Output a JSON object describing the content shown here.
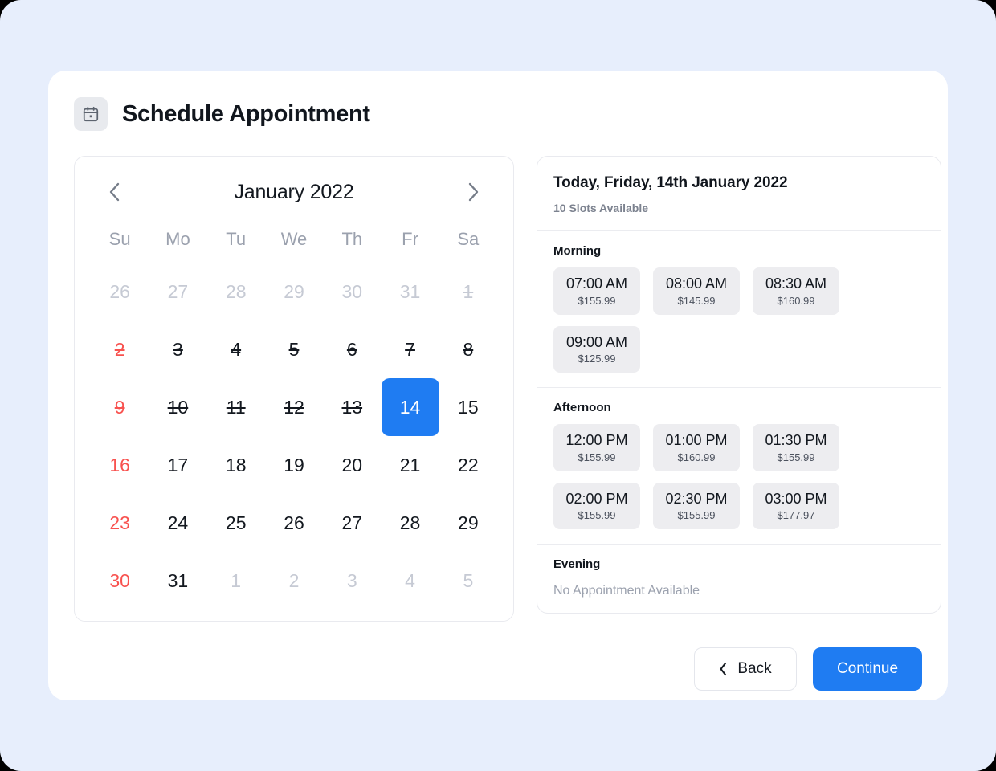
{
  "header": {
    "icon": "calendar-icon",
    "title": "Schedule Appointment"
  },
  "calendar": {
    "prev_icon": "chevron-left-icon",
    "next_icon": "chevron-right-icon",
    "month_label": "January 2022",
    "weekday_labels": [
      "Su",
      "Mo",
      "Tu",
      "We",
      "Th",
      "Fr",
      "Sa"
    ],
    "selected_day": "14",
    "accent_color": "#1f7cf2",
    "weekend_color": "#f8524f",
    "muted_color": "#c6cad4",
    "weeks": [
      [
        {
          "label": "26",
          "state": "outside"
        },
        {
          "label": "27",
          "state": "outside"
        },
        {
          "label": "28",
          "state": "outside"
        },
        {
          "label": "29",
          "state": "outside"
        },
        {
          "label": "30",
          "state": "outside"
        },
        {
          "label": "31",
          "state": "outside"
        },
        {
          "label": "1",
          "state": "outside-past"
        }
      ],
      [
        {
          "label": "2",
          "state": "past-weekend"
        },
        {
          "label": "3",
          "state": "past"
        },
        {
          "label": "4",
          "state": "past"
        },
        {
          "label": "5",
          "state": "past"
        },
        {
          "label": "6",
          "state": "past"
        },
        {
          "label": "7",
          "state": "past"
        },
        {
          "label": "8",
          "state": "past"
        }
      ],
      [
        {
          "label": "9",
          "state": "past-weekend"
        },
        {
          "label": "10",
          "state": "past"
        },
        {
          "label": "11",
          "state": "past"
        },
        {
          "label": "12",
          "state": "past"
        },
        {
          "label": "13",
          "state": "past"
        },
        {
          "label": "14",
          "state": "selected"
        },
        {
          "label": "15",
          "state": "available"
        }
      ],
      [
        {
          "label": "16",
          "state": "weekend"
        },
        {
          "label": "17",
          "state": "available"
        },
        {
          "label": "18",
          "state": "available"
        },
        {
          "label": "19",
          "state": "available"
        },
        {
          "label": "20",
          "state": "available"
        },
        {
          "label": "21",
          "state": "available"
        },
        {
          "label": "22",
          "state": "available"
        }
      ],
      [
        {
          "label": "23",
          "state": "weekend"
        },
        {
          "label": "24",
          "state": "available"
        },
        {
          "label": "25",
          "state": "available"
        },
        {
          "label": "26",
          "state": "available"
        },
        {
          "label": "27",
          "state": "available"
        },
        {
          "label": "28",
          "state": "available"
        },
        {
          "label": "29",
          "state": "available"
        }
      ],
      [
        {
          "label": "30",
          "state": "weekend"
        },
        {
          "label": "31",
          "state": "available"
        },
        {
          "label": "1",
          "state": "outside"
        },
        {
          "label": "2",
          "state": "outside"
        },
        {
          "label": "3",
          "state": "outside"
        },
        {
          "label": "4",
          "state": "outside"
        },
        {
          "label": "5",
          "state": "outside"
        }
      ]
    ]
  },
  "slots": {
    "date_heading": "Today, Friday, 14th January 2022",
    "availability": "10 Slots Available",
    "sections": [
      {
        "label": "Morning",
        "empty_text": "",
        "items": [
          {
            "time": "07:00 AM",
            "price": "$155.99"
          },
          {
            "time": "08:00 AM",
            "price": "$145.99"
          },
          {
            "time": "08:30 AM",
            "price": "$160.99"
          },
          {
            "time": "09:00 AM",
            "price": "$125.99"
          }
        ]
      },
      {
        "label": "Afternoon",
        "empty_text": "",
        "items": [
          {
            "time": "12:00 PM",
            "price": "$155.99"
          },
          {
            "time": "01:00 PM",
            "price": "$160.99"
          },
          {
            "time": "01:30 PM",
            "price": "$155.99"
          },
          {
            "time": "02:00 PM",
            "price": "$155.99"
          },
          {
            "time": "02:30 PM",
            "price": "$155.99"
          },
          {
            "time": "03:00 PM",
            "price": "$177.97"
          }
        ]
      },
      {
        "label": "Evening",
        "empty_text": "No Appointment Available",
        "items": []
      }
    ]
  },
  "footer": {
    "back_label": "Back",
    "back_icon": "chevron-left-icon",
    "continue_label": "Continue"
  }
}
